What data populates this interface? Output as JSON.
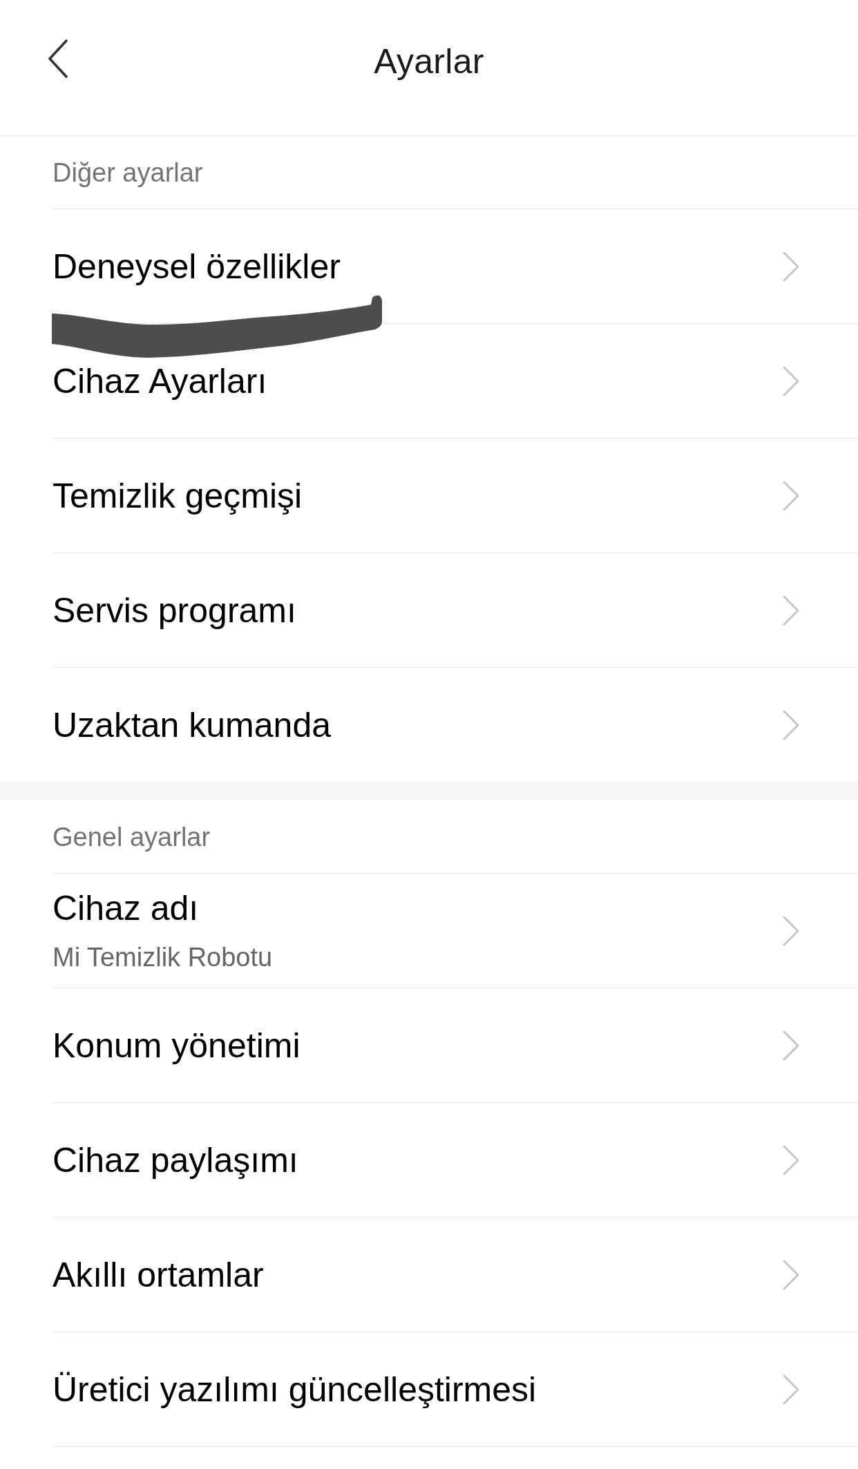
{
  "header": {
    "title": "Ayarlar"
  },
  "sections": [
    {
      "title": "Diğer ayarlar",
      "items": [
        {
          "label": "Deneysel özellikler"
        },
        {
          "label": "Cihaz Ayarları"
        },
        {
          "label": "Temizlik geçmişi"
        },
        {
          "label": "Servis programı"
        },
        {
          "label": "Uzaktan kumanda"
        }
      ]
    },
    {
      "title": "Genel ayarlar",
      "items": [
        {
          "label": "Cihaz adı",
          "value": "Mi Temizlik Robotu"
        },
        {
          "label": "Konum yönetimi"
        },
        {
          "label": "Cihaz paylaşımı"
        },
        {
          "label": "Akıllı ortamlar"
        },
        {
          "label": "Üretici yazılımı güncelleştirmesi"
        }
      ]
    }
  ]
}
